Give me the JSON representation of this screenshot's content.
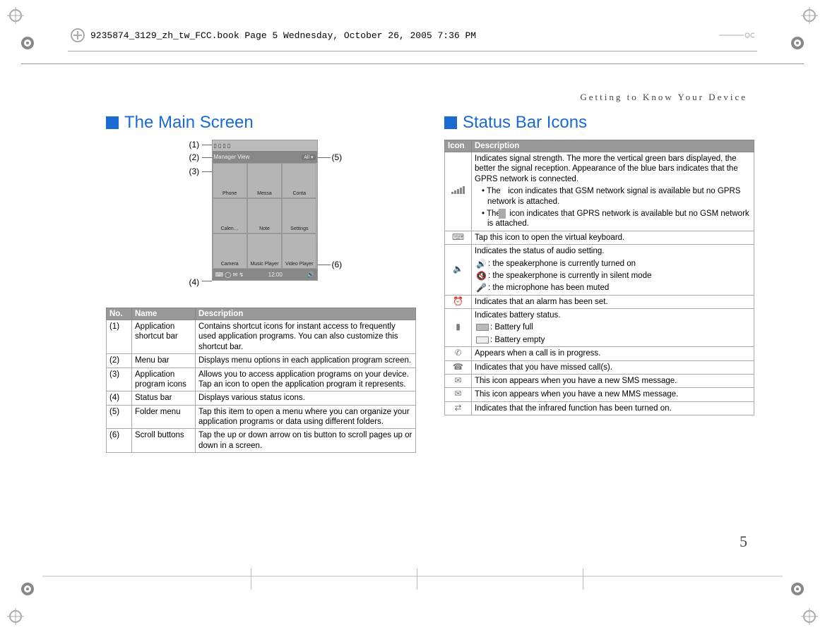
{
  "header": {
    "stamp": "9235874_3129_zh_tw_FCC.book  Page 5  Wednesday, October 26, 2005  7:36 PM"
  },
  "running_head": "Getting to Know Your Device",
  "page_number": "5",
  "left": {
    "heading": "The Main Screen",
    "callouts": {
      "c1": "(1)",
      "c2": "(2)",
      "c3": "(3)",
      "c4": "(4)",
      "c5": "(5)",
      "c6": "(6)"
    },
    "phone": {
      "menubar_items": [
        "Manager",
        "View"
      ],
      "folder_label": "All ▾",
      "grid_labels": [
        "Phone",
        "Messa",
        "Conta",
        "Calen…",
        "Note",
        "Settings",
        "Camera",
        "Music Player",
        "Video Player"
      ],
      "status_time": "12:00"
    },
    "table": {
      "headers": {
        "no": "No.",
        "name": "Name",
        "desc": "Description"
      },
      "rows": [
        {
          "no": "(1)",
          "name": "Application shortcut bar",
          "desc": "Contains shortcut icons for instant access to frequently used application programs. You can also customize this shortcut bar."
        },
        {
          "no": "(2)",
          "name": "Menu bar",
          "desc": "Displays menu options in each application program screen."
        },
        {
          "no": "(3)",
          "name": "Application program icons",
          "desc": "Allows you to access application programs on your device. Tap an icon to open the application program it represents."
        },
        {
          "no": "(4)",
          "name": "Status bar",
          "desc": "Displays various status icons."
        },
        {
          "no": "(5)",
          "name": "Folder menu",
          "desc": "Tap this item to open a menu where you can organize your application programs or data using different folders."
        },
        {
          "no": "(6)",
          "name": "Scroll buttons",
          "desc": "Tap the up or down arrow on tis button to scroll pages up or down in a screen."
        }
      ]
    }
  },
  "right": {
    "heading": "Status Bar Icons",
    "table": {
      "headers": {
        "icon": "Icon",
        "desc": "Description"
      },
      "rows": [
        {
          "icon_name": "signal-strength-icon",
          "desc_main": "Indicates signal strength. The more the vertical green bars displayed, the better the signal reception. Appearance of the blue bars indicates that the GPRS network is connected.",
          "bullet1_pre": "• The ",
          "bullet1_post": " icon indicates that GSM network signal is available but no GPRS network is attached.",
          "bullet2_pre": "• The ",
          "bullet2_post": " icon indicates that GPRS network is available but no GSM network is attached."
        },
        {
          "icon_name": "keyboard-icon",
          "desc": "Tap this icon to open the virtual keyboard."
        },
        {
          "icon_name": "audio-status-icon",
          "desc_intro": "Indicates the status of audio setting.",
          "line1": ": the speakerphone is currently turned on",
          "line2": ": the speakerphone is currently in silent mode",
          "line3": ": the microphone has been muted"
        },
        {
          "icon_name": "alarm-icon",
          "desc": "Indicates that an alarm has been set."
        },
        {
          "icon_name": "battery-icon",
          "desc_intro": "Indicates battery status.",
          "line1": ": Battery full",
          "line2": ": Battery empty"
        },
        {
          "icon_name": "call-in-progress-icon",
          "desc": "Appears when a call is in progress."
        },
        {
          "icon_name": "missed-call-icon",
          "desc": "Indicates that you have missed call(s)."
        },
        {
          "icon_name": "sms-icon",
          "desc": "This icon appears when you have a new SMS message."
        },
        {
          "icon_name": "mms-icon",
          "desc": "This icon appears when you have a new MMS message."
        },
        {
          "icon_name": "infrared-icon",
          "desc": "Indicates that the infrared function has been turned on."
        }
      ]
    }
  }
}
